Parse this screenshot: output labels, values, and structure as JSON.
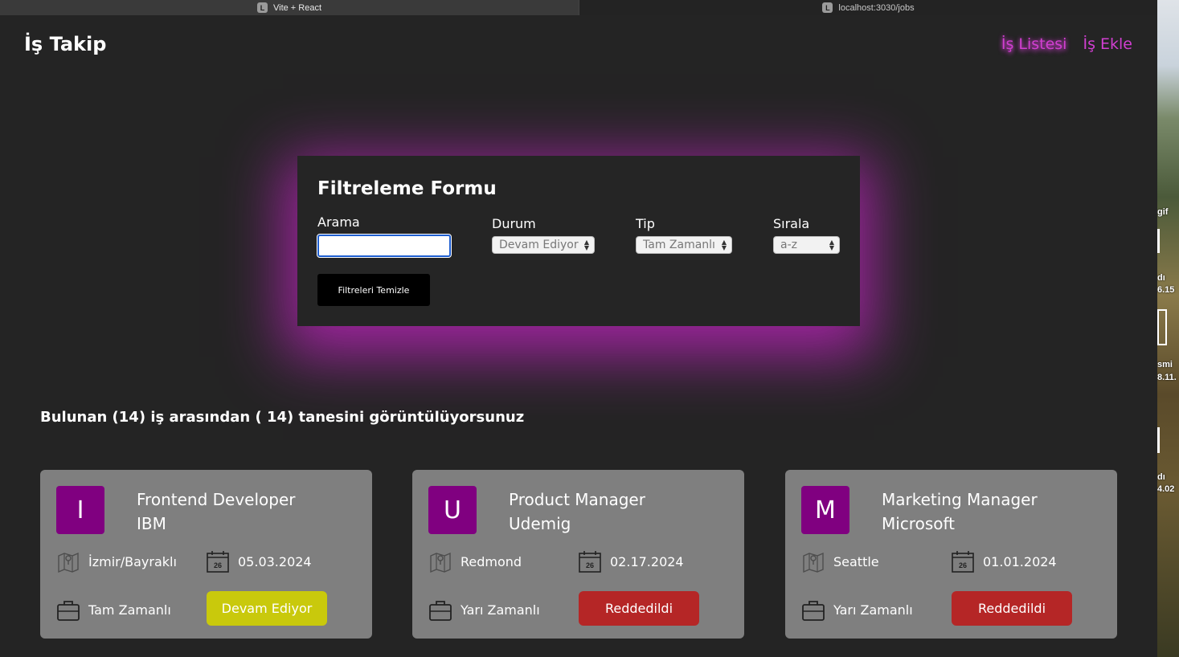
{
  "browser": {
    "tabs": [
      {
        "favicon": "L",
        "title": "Vite + React"
      },
      {
        "favicon": "L",
        "title": "localhost:3030/jobs"
      }
    ]
  },
  "desktop": {
    "labels": [
      "gif",
      "dı",
      "6.15",
      "smi",
      "8.11.",
      "dı",
      "4.02"
    ]
  },
  "header": {
    "brand": "İş Takip",
    "nav": [
      {
        "label": "İş Listesi",
        "active": true
      },
      {
        "label": "İş Ekle",
        "active": false
      }
    ]
  },
  "filter": {
    "title": "Filtreleme Formu",
    "search": {
      "label": "Arama",
      "value": "",
      "placeholder": ""
    },
    "status": {
      "label": "Durum",
      "selected": "Devam Ediyor"
    },
    "type": {
      "label": "Tip",
      "selected": "Tam Zamanlı"
    },
    "sort": {
      "label": "Sırala",
      "selected": "a-z"
    },
    "clear_label": "Filtreleri Temizle"
  },
  "summary": "Bulunan (14) iş arasından ( 14) tanesini görüntülüyorsunuz",
  "jobs": [
    {
      "initial": "I",
      "position": "Frontend Developer",
      "company": "IBM",
      "location": "İzmir/Bayraklı",
      "date": "05.03.2024",
      "type": "Tam Zamanlı",
      "status": "Devam Ediyor",
      "status_color": "#c9c90c"
    },
    {
      "initial": "U",
      "position": "Product Manager",
      "company": "Udemig",
      "location": "Redmond",
      "date": "02.17.2024",
      "type": "Yarı Zamanlı",
      "status": "Reddedildi",
      "status_color": "#b52626"
    },
    {
      "initial": "M",
      "position": "Marketing Manager",
      "company": "Microsoft",
      "location": "Seattle",
      "date": "01.01.2024",
      "type": "Yarı Zamanlı",
      "status": "Reddedildi",
      "status_color": "#b52626"
    }
  ],
  "calendar_day": "26",
  "colors": {
    "accent": "#d13fd1",
    "glow": "#c424c4",
    "avatar": "#800080",
    "card": "#7f7f7f",
    "background": "#242424"
  }
}
